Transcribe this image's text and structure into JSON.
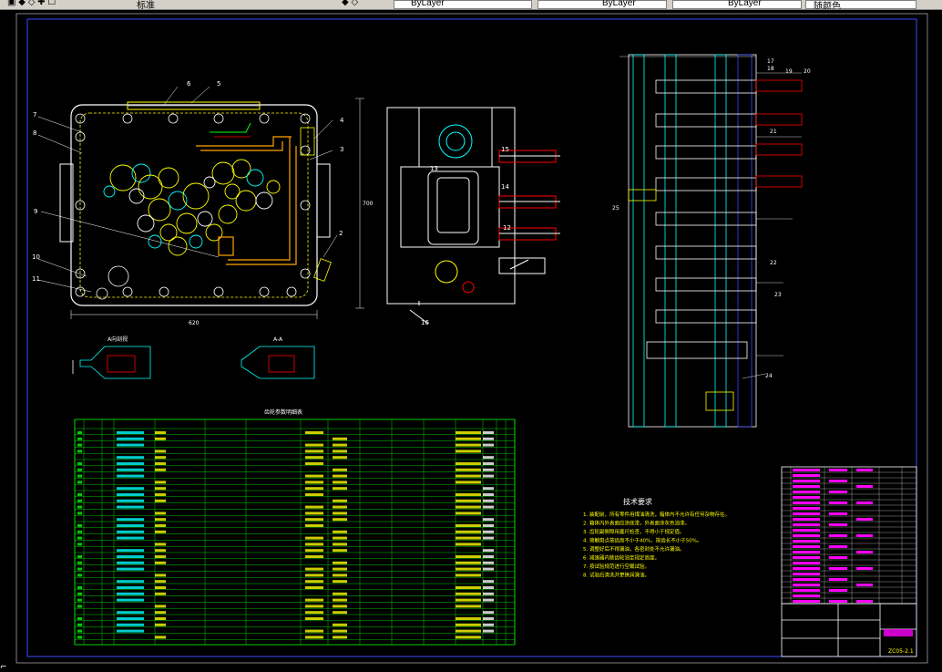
{
  "toolbar": {
    "layer_label": "标准",
    "layer1": "ByLayer",
    "layer2": "ByLayer",
    "layer3": "ByLayer",
    "plot_label": "随颜色"
  },
  "drawing": {
    "section_left_label": "A向剖视",
    "section_right_label": "A-A",
    "table_title": "齿轮参数明细表",
    "tech_req_title": "技术要求",
    "tech_req_lines": [
      "1. 装配前，所有零件用煤油清洗，箱体内不允许有任何杂物存在。",
      "2. 箱体内外表面应涂底漆，外表面涂灰色油漆。",
      "3. 齿轮副侧隙用塞尺检查，不得小于规定值。",
      "4. 接触斑点按齿高不小于40%，按齿长不小于50%。",
      "5. 调整好后不得漏油，各密封处不允许漏油。",
      "6. 减速器内装齿轮油至规定高度。",
      "7. 按试验规范进行空载试验。",
      "8. 试验后清洗并更换润滑油。"
    ],
    "drawing_number": "ZC05-2.1",
    "callouts_main": [
      "6",
      "5",
      "7",
      "8",
      "4",
      "3",
      "9",
      "2",
      "10",
      "11"
    ],
    "callouts_side": [
      "15",
      "14",
      "13",
      "12",
      "16"
    ],
    "callouts_section": [
      "17",
      "18",
      "19",
      "20",
      "21",
      "22",
      "23",
      "24",
      "25"
    ],
    "dims_main": [
      "620",
      "700"
    ]
  }
}
